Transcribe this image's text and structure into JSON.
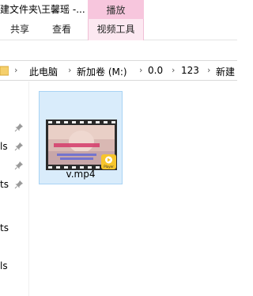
{
  "window": {
    "title": "建文件夹\\王馨瑶 -..."
  },
  "ribbon": {
    "context_tab": "播放",
    "tabs": [
      {
        "label": "共享",
        "active": false
      },
      {
        "label": "查看",
        "active": false
      },
      {
        "label": "视频工具",
        "active": true
      }
    ]
  },
  "address": {
    "crumbs": [
      "此电脑",
      "新加卷 (M:)",
      "0.0",
      "123",
      "新建"
    ]
  },
  "nav": {
    "fragments": [
      "ls",
      "ts",
      "ts",
      "ls"
    ]
  },
  "files": [
    {
      "name": "v.mp4",
      "selected": true,
      "thumb_caption": "Player"
    }
  ],
  "colors": {
    "context_tab": "#f7c6dd",
    "selection_bg": "#d9ecfb",
    "selection_border": "#a8d3f5"
  },
  "icons": [
    "folder-icon",
    "pin-icon",
    "video-thumbnail-icon",
    "player-badge-icon"
  ]
}
